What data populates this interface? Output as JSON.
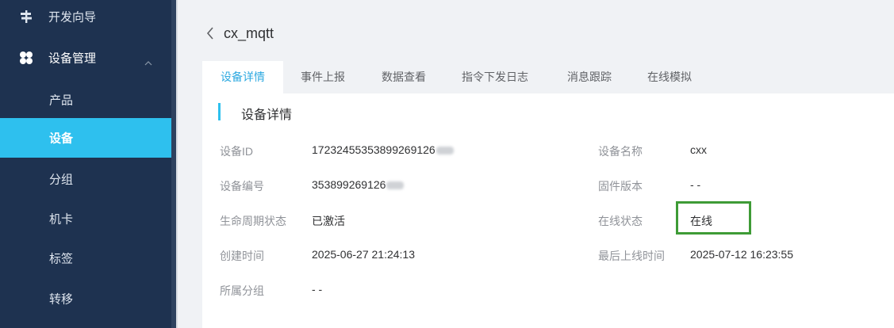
{
  "sidebar": {
    "items": [
      {
        "label": "开发向导",
        "icon": "signpost-icon"
      },
      {
        "label": "设备管理",
        "icon": "grid-clover-icon",
        "expanded": true
      }
    ],
    "sub_items": [
      {
        "label": "产品"
      },
      {
        "label": "设备",
        "active": true
      },
      {
        "label": "分组"
      },
      {
        "label": "机卡"
      },
      {
        "label": "标签"
      },
      {
        "label": "转移"
      }
    ]
  },
  "header": {
    "title": "cx_mqtt"
  },
  "tabs": [
    {
      "label": "设备详情",
      "active": true
    },
    {
      "label": "事件上报"
    },
    {
      "label": "数据查看"
    },
    {
      "label": "指令下发日志"
    },
    {
      "label": "消息跟踪"
    },
    {
      "label": "在线模拟"
    }
  ],
  "details": {
    "section_title": "设备详情",
    "left": [
      {
        "label": "设备ID",
        "value": "17232455353899269126"
      },
      {
        "label": "设备编号",
        "value": "353899269126"
      },
      {
        "label": "生命周期状态",
        "value": "已激活"
      },
      {
        "label": "创建时间",
        "value": "2025-06-27 21:24:13"
      },
      {
        "label": "所属分组",
        "value": "- -"
      }
    ],
    "right": [
      {
        "label": "设备名称",
        "value": "cxx"
      },
      {
        "label": "固件版本",
        "value": "- -"
      },
      {
        "label": "在线状态",
        "value": "在线"
      },
      {
        "label": "最后上线时间",
        "value": "2025-07-12 16:23:55"
      }
    ]
  },
  "colors": {
    "sidebar_bg": "#1e3250",
    "accent": "#2ec0ee",
    "highlight_border": "#3e9b36"
  }
}
